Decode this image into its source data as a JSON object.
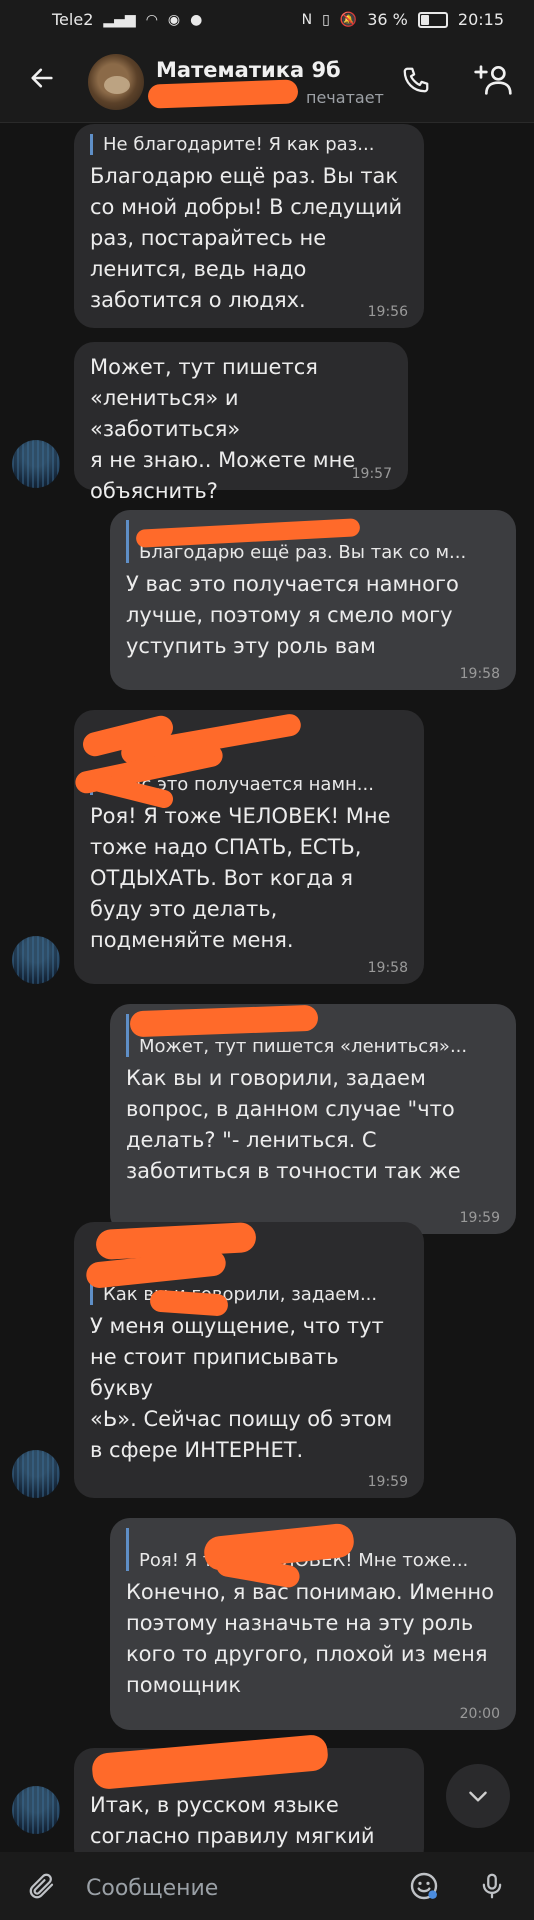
{
  "status_bar": {
    "carrier": "Tele2",
    "battery": "36 %",
    "time": "20:15",
    "battery_level": 0.36
  },
  "header": {
    "title": "Математика 9б",
    "subtitle": "печатает"
  },
  "messages": [
    {
      "side": "in",
      "reply_author": "",
      "reply_text": "Не благодарите! Я как раз...",
      "text": "Благодарю ещё раз. Вы так\nсо мной добры! В следущий\nраз, постарайтесь не\nленится, ведь надо\nзаботится о людях.",
      "time": "19:56"
    },
    {
      "side": "in",
      "text": "Может, тут пишется\n«лениться» и «заботиться»\nя не знаю.. Можете мне\nобъяснить?",
      "time": "19:57"
    },
    {
      "side": "out",
      "reply_author": "",
      "reply_text": "Благодарю ещё раз. Вы так со м...",
      "text": "У вас это получается намного\nлучше, поэтому я смело могу\nуступить эту роль вам",
      "time": "19:58"
    },
    {
      "side": "in",
      "reply_author": "",
      "reply_text": "У вас это получается намн...",
      "text": "Роя! Я тоже ЧЕЛОВЕК! Мне\nтоже надо СПАТЬ, ЕСТЬ,\nОТДЫХАТЬ. Вот когда я\nбуду это делать,\nподменяйте меня.",
      "time": "19:58"
    },
    {
      "side": "out",
      "reply_author": "",
      "reply_text": "Может, тут пишется «лениться»...",
      "text": "Как вы и говорили, задаем\nвопрос, в данном случае \"что\nделать? \"- лениться. С\nзаботиться в точности так же",
      "time": "19:59"
    },
    {
      "side": "in",
      "reply_author": "",
      "reply_text": "Как вы и говорили, задаем...",
      "text": "У меня ощущение, что тут\nне стоит приписывать букву\n«Ь». Сейчас поищу об этом\nв сфере ИНТЕРНЕТ.",
      "time": "19:59"
    },
    {
      "side": "out",
      "reply_author": "",
      "reply_text": "Роя! Я тоже ЧЕЛОВЕК! Мне тоже...",
      "text": "Конечно, я вас понимаю. Именно\nпоэтому назначьте на эту роль\nкого то другого, плохой из меня\nпомощник",
      "time": "20:00"
    },
    {
      "side": "in",
      "reply_author": "",
      "text": "Итак, в русском языке\nсогласно правилу мягкий",
      "time": ""
    }
  ],
  "composer": {
    "placeholder": "Сообщение"
  },
  "colors": {
    "background": "#141414",
    "bubble_in": "#2b2b2d",
    "bubble_out": "#3c3d40",
    "accent": "#6ea2df",
    "redaction": "#ff6a2a"
  },
  "icons": {
    "back": "arrow-left-icon",
    "call": "phone-icon",
    "add_user": "add-user-icon",
    "attach": "paperclip-icon",
    "emoji": "emoji-icon",
    "mic": "microphone-icon",
    "scroll_down": "chevron-down-icon"
  }
}
